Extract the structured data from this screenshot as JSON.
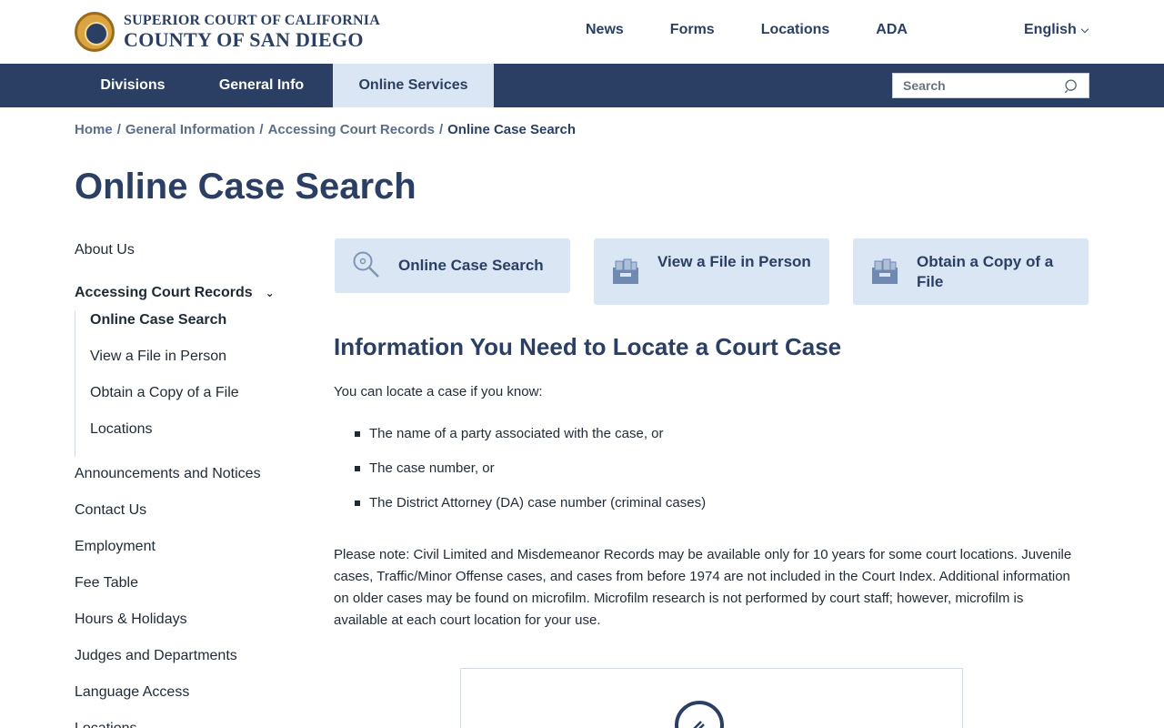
{
  "header": {
    "logo_line1": "SUPERIOR COURT OF CALIFORNIA",
    "logo_line2": "COUNTY OF SAN DIEGO",
    "nav": [
      "News",
      "Forms",
      "Locations",
      "ADA"
    ],
    "language": "English"
  },
  "mainnav": {
    "tabs": [
      "Divisions",
      "General Info",
      "Online Services"
    ],
    "active_tab": "Online Services",
    "search_placeholder": "Search"
  },
  "breadcrumb": [
    "Home",
    "General Information",
    "Accessing Court Records",
    "Online Case Search"
  ],
  "page_title": "Online Case Search",
  "sidebar": {
    "items_before": [
      "About Us"
    ],
    "expanded": "Accessing Court Records",
    "sub_items": [
      "Online Case Search",
      "View a File in Person",
      "Obtain a Copy of a File",
      "Locations"
    ],
    "current_sub": "Online Case Search",
    "items_after": [
      "Announcements and Notices",
      "Contact Us",
      "Employment",
      "Fee Table",
      "Hours & Holidays",
      "Judges and Departments",
      "Language Access",
      "Locations"
    ]
  },
  "cards": [
    {
      "label": "Online Case Search",
      "icon": "magnifier-icon"
    },
    {
      "label": "View a File in Person",
      "icon": "file-box-icon"
    },
    {
      "label": "Obtain a Copy of a File",
      "icon": "file-box-icon"
    }
  ],
  "content": {
    "section_title": "Information You Need to Locate a Court Case",
    "intro": "You can locate a case if you know:",
    "bullets": [
      "The name of a party associated with the case,  or",
      "The case number, or",
      "The District Attorney (DA) case number (criminal cases)"
    ],
    "note": "Please note: Civil Limited and Misdemeanor Records may be available only for 10 years for some court locations. Juvenile cases, Traffic/Minor Offense cases, and cases from before 1974 are not included in the Court Index. Additional information on older cases may be found on microfilm. Microfilm research is not performed by court staff; however, microfilm is available at each court location for your use."
  },
  "colors": {
    "brand_navy": "#2a3f63",
    "card_bg": "#dbe6f4",
    "link_grey": "#5b6d89"
  }
}
